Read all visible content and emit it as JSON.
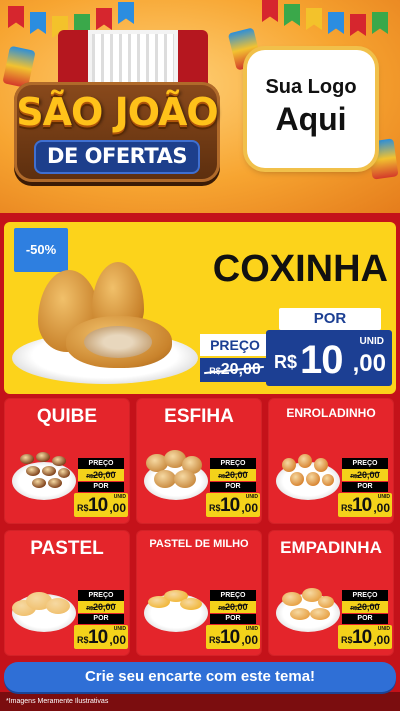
{
  "header": {
    "title_main": "SÃO JOÃO",
    "title_sub": "DE OFERTAS",
    "logo_line1": "Sua Logo",
    "logo_line2": "Aqui"
  },
  "featured": {
    "discount": "-50%",
    "name": "COXINHA",
    "old_label": "PREÇO",
    "old_currency": "R$",
    "old_price": "20,00",
    "new_label": "POR",
    "new_currency": "R$",
    "new_int": "10",
    "new_cents": ",00",
    "unit": "UNID"
  },
  "price_tag": {
    "old_label": "PREÇO",
    "old_currency": "R$",
    "old_price": "20,00",
    "new_label": "POR",
    "new_currency": "R$",
    "new_int": "10",
    "new_cents": ",00",
    "unit": "UNID"
  },
  "products": [
    {
      "name": "QUIBE"
    },
    {
      "name": "ESFIHA"
    },
    {
      "name": "ENROLADINHO"
    },
    {
      "name": "PASTEL"
    },
    {
      "name": "PASTEL DE MILHO"
    },
    {
      "name": "EMPADINHA"
    }
  ],
  "cta": "Crie seu encarte com este tema!",
  "footnote": "*Imagens Meramente Ilustrativas",
  "colors": {
    "background_red": "#c4121a",
    "card_red": "#e4252b",
    "featured_yellow": "#fcd31b",
    "price_blue": "#1c3f93",
    "cta_blue": "#2f6fd6"
  }
}
